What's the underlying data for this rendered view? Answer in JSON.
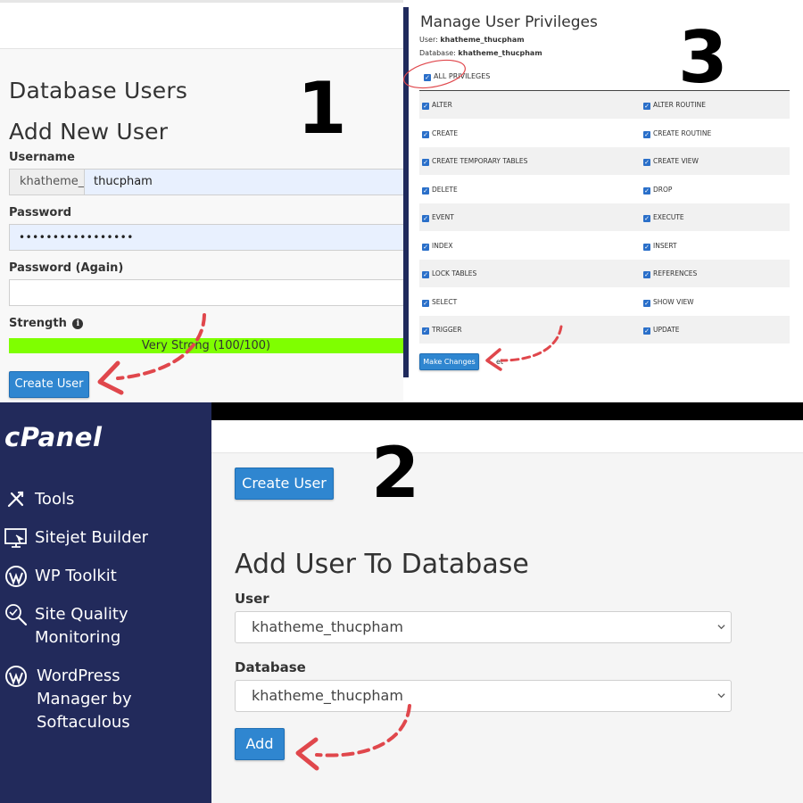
{
  "panel1": {
    "title": "Database Users",
    "subtitle": "Add New User",
    "username_label": "Username",
    "username_prefix": "khatheme_",
    "username_value": "thucpham",
    "password_label": "Password",
    "password_value": "•••••••••••••••••",
    "password_again_label": "Password (Again)",
    "password_again_value": "",
    "strength_label": "Strength",
    "strength_text": "Very Strong (100/100)",
    "strength_percent": 100,
    "strength_color": "#7fff00",
    "create_button": "Create User",
    "step_number": "1"
  },
  "panel3": {
    "title": "Manage User Privileges",
    "user_label": "User:",
    "user_value": "khatheme_thucpham",
    "database_label": "Database:",
    "database_value": "khatheme_thucpham",
    "all_privileges": "ALL PRIVILEGES",
    "privileges_left": [
      "ALTER",
      "CREATE",
      "CREATE TEMPORARY TABLES",
      "DELETE",
      "EVENT",
      "INDEX",
      "LOCK TABLES",
      "SELECT",
      "TRIGGER"
    ],
    "privileges_right": [
      "ALTER ROUTINE",
      "CREATE ROUTINE",
      "CREATE VIEW",
      "DROP",
      "EXECUTE",
      "INSERT",
      "REFERENCES",
      "SHOW VIEW",
      "UPDATE"
    ],
    "make_changes_button": "Make Changes",
    "reset_text": "et",
    "step_number": "3"
  },
  "panel2": {
    "logo": "cPanel",
    "nav": [
      {
        "label": "Tools",
        "icon": "tools-icon"
      },
      {
        "label": "Sitejet Builder",
        "icon": "sitejet-icon"
      },
      {
        "label": "WP Toolkit",
        "icon": "wordpress-icon"
      },
      {
        "label": "Site Quality\nMonitoring",
        "icon": "site-quality-icon"
      },
      {
        "label": "WordPress\nManager by\nSoftaculous",
        "icon": "wordpress-icon"
      }
    ],
    "create_button": "Create User",
    "heading": "Add User To Database",
    "user_label": "User",
    "user_select": "khatheme_thucpham",
    "database_label": "Database",
    "database_select": "khatheme_thucpham",
    "add_button": "Add",
    "step_number": "2"
  },
  "colors": {
    "accent_blue": "#2f86d0",
    "sidebar_navy": "#222a5b",
    "annotation_red": "#e0474c",
    "strength_green": "#7fff00"
  }
}
